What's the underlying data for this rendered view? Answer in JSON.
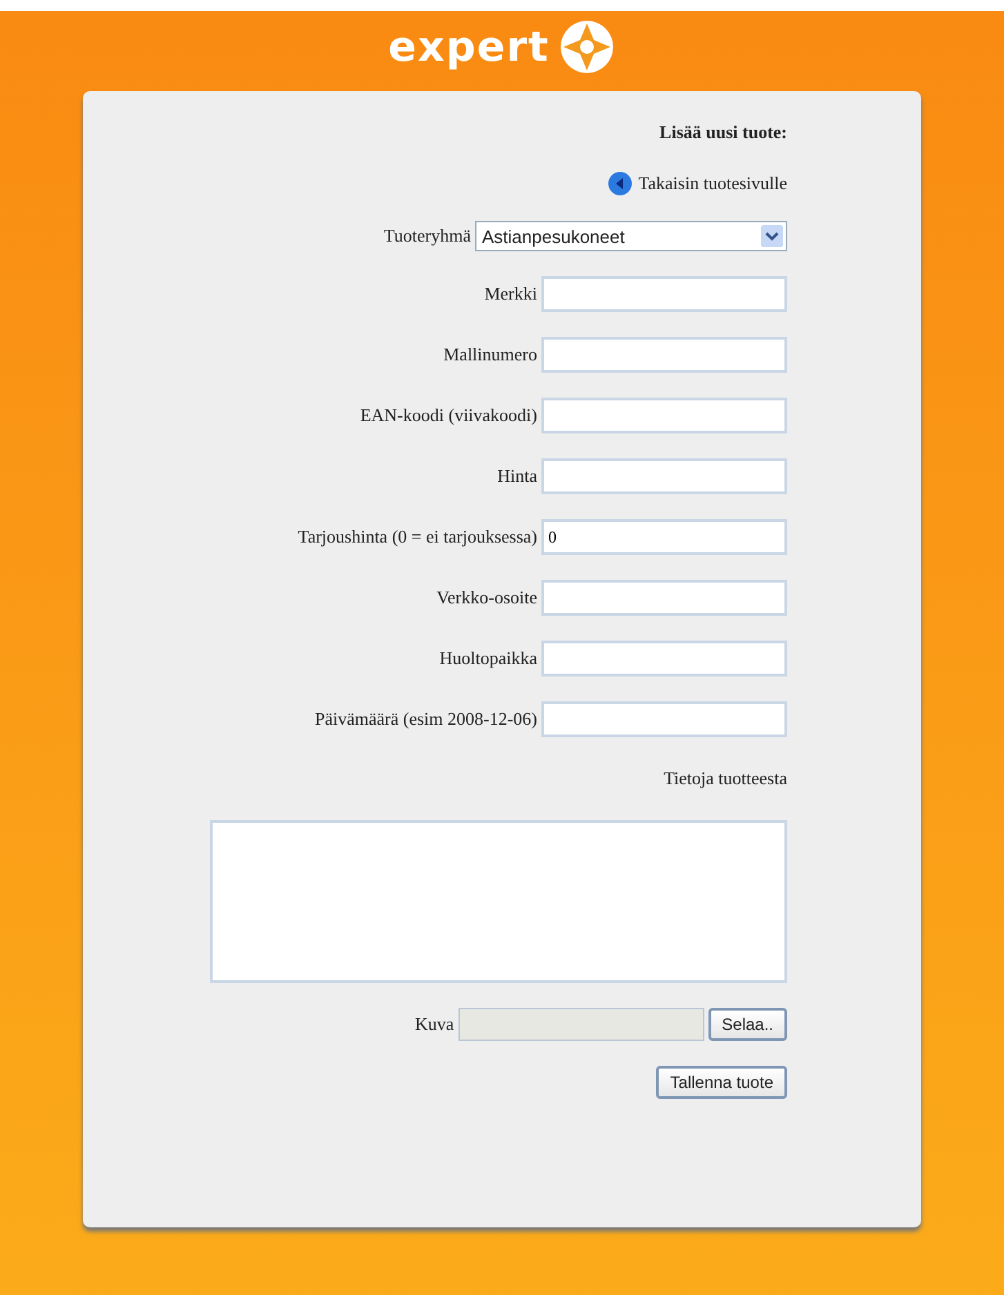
{
  "logo": {
    "text": "expert"
  },
  "form": {
    "title": "Lisää uusi tuote:",
    "back_link": "Takaisin tuotesivulle",
    "category": {
      "label": "Tuoteryhmä",
      "value": "Astianpesukoneet"
    },
    "fields": [
      {
        "label": "Merkki"
      },
      {
        "label": "Mallinumero"
      },
      {
        "label": "EAN-koodi (viivakoodi)"
      },
      {
        "label": "Hinta"
      },
      {
        "label": "Tarjoushinta (0 = ei tarjouksessa)",
        "value": "0"
      },
      {
        "label": "Verkko-osoite"
      },
      {
        "label": "Huoltopaikka"
      },
      {
        "label": "Päivämäärä (esim 2008-12-06)"
      }
    ],
    "description": {
      "label": "Tietoja tuotteesta"
    },
    "image": {
      "label": "Kuva",
      "browse_button": "Selaa.."
    },
    "save_button": "Tallenna tuote"
  }
}
